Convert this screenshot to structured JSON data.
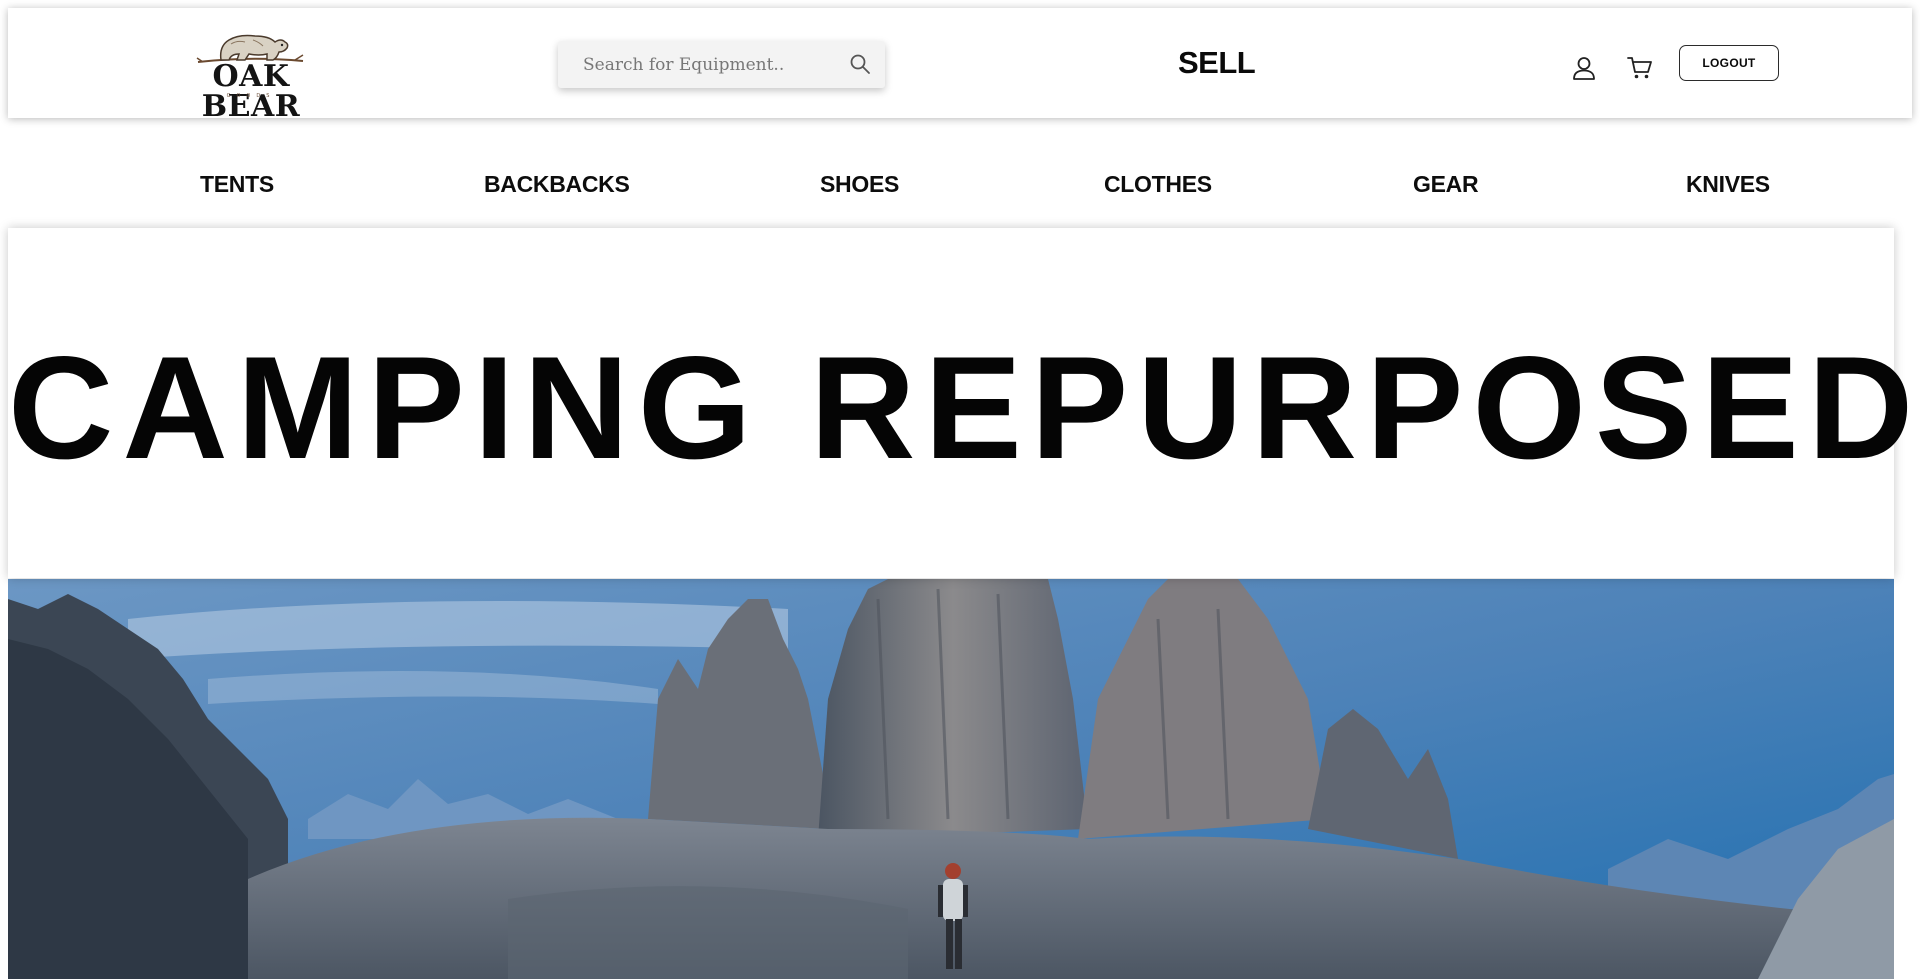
{
  "header": {
    "logo": {
      "name": "OAK BEAR",
      "tagline": "GOODS",
      "icon": "bear-icon"
    },
    "search": {
      "placeholder": "Search for Equipment..",
      "value": "",
      "icon": "search-icon"
    },
    "sell_label": "SELL",
    "user_icon": "user-icon",
    "cart_icon": "cart-icon",
    "logout_label": "LOGOUT"
  },
  "categories": [
    "TENTS",
    "BACKBACKS",
    "SHOES",
    "CLOTHES",
    "GEAR",
    "KNIVES"
  ],
  "hero": {
    "title": "CAMPING REPURPOSED"
  },
  "colors": {
    "text": "#0a0a0a",
    "header_bg": "#ffffff",
    "search_bg": "#f3f3f3",
    "sky": "#3f7bb3",
    "rock": "#6f7480"
  }
}
